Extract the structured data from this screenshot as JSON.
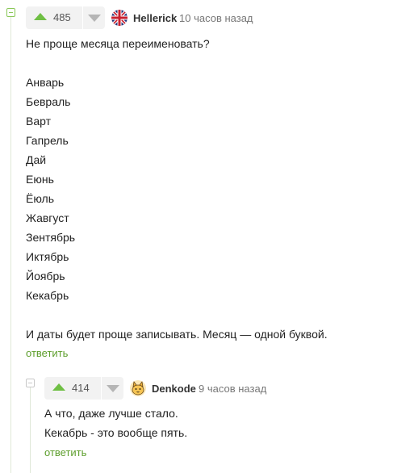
{
  "comments": [
    {
      "rating": "485",
      "author": "Hellerick",
      "time": "10 часов назад",
      "lines": [
        "Не проще месяца переименовать?",
        "",
        "Анварь",
        "Бевраль",
        "Варт",
        "Гапрель",
        "Дай",
        "Еюнь",
        "Ёюль",
        "Жавгуст",
        "Зентябрь",
        "Иктябрь",
        "Йоябрь",
        "Кекабрь",
        "",
        "И даты будет проще записывать. Месяц — одной буквой."
      ],
      "reply_label": "ответить",
      "avatar_icon": "union-jack-avatar-icon"
    },
    {
      "rating": "414",
      "author": "Denkode",
      "time": "9 часов назад",
      "lines": [
        "А что, даже лучше стало.",
        "Кекабрь - это вообще пять."
      ],
      "reply_label": "ответить",
      "avatar_icon": "cat-face-avatar-icon"
    }
  ],
  "colors": {
    "accent_green": "#6fbf44",
    "link_green": "#5d9e2c",
    "muted_grey": "#777777"
  }
}
